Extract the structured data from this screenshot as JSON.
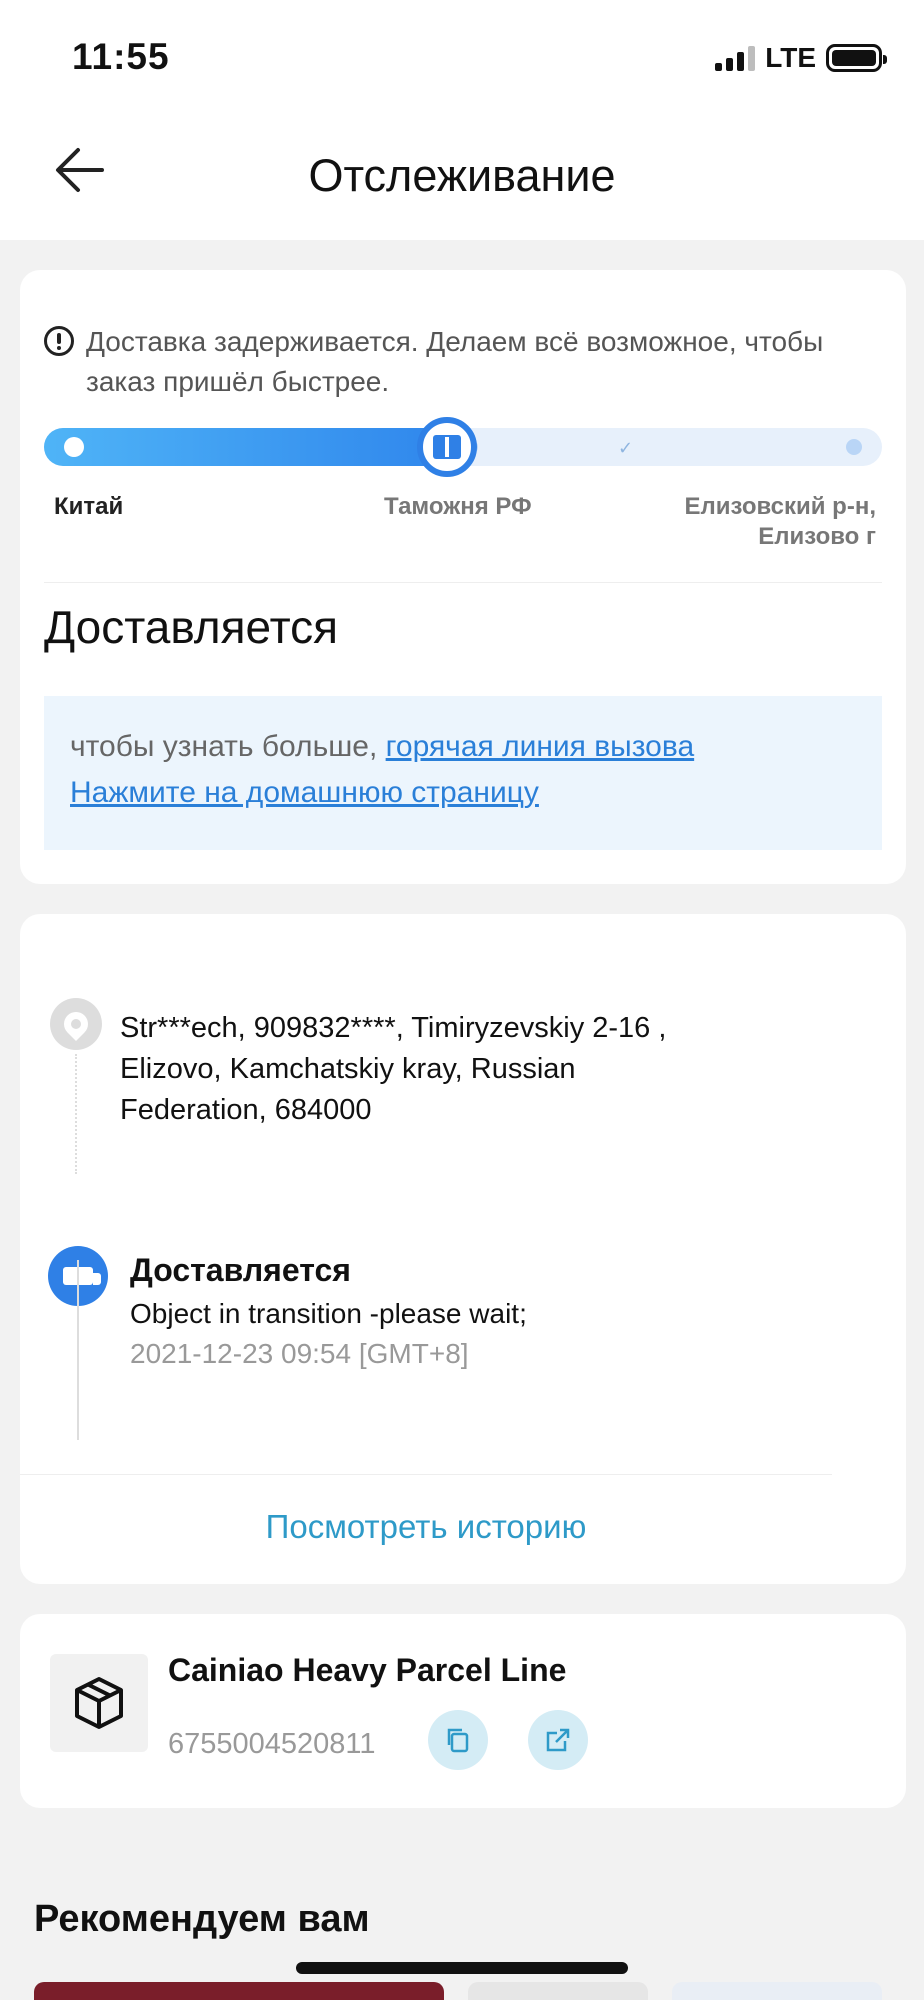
{
  "status_bar": {
    "time": "11:55",
    "network": "LTE"
  },
  "header": {
    "title": "Отслеживание"
  },
  "delivery": {
    "notice": "Доставка задерживается. Делаем всё возможное, чтобы заказ пришёл быстрее.",
    "progress_fraction": 0.49,
    "stages": [
      "Китай",
      "Таможня РФ",
      "Елизовский р-н, Елизово г"
    ],
    "status": "Доставляется",
    "info_text": "чтобы узнать больше,",
    "hotline_link": "горячая линия вызова",
    "homepage_link": "Нажмите на домашнюю страницу"
  },
  "timeline": {
    "address": "Str***ech,  909832****,  Timiryzevskiy 2-16 ,  Elizovo,  Kamchatskiy kray,  Russian Federation,  684000",
    "event_title": "Доставляется",
    "event_desc": "Object in transition -please wait;",
    "event_time": "2021-12-23 09:54 [GMT+8]",
    "history_button": "Посмотреть историю"
  },
  "carrier": {
    "name": "Cainiao Heavy Parcel Line",
    "tracking_number": "6755004520811",
    "icons": [
      "package-icon",
      "copy-icon",
      "open-link-icon"
    ]
  },
  "recommend": {
    "title": "Рекомендуем вам"
  },
  "colors": {
    "accent": "#2f80e6",
    "link": "#2a7fd8",
    "history": "#2e9ac8"
  }
}
